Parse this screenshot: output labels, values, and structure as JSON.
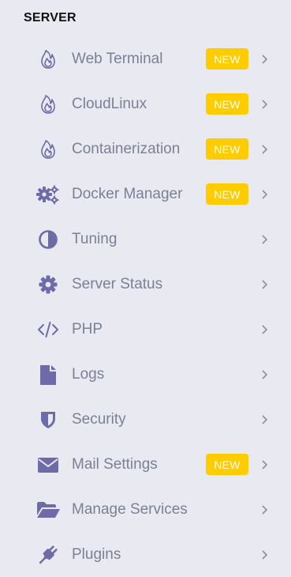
{
  "section_title": "SERVER",
  "colors": {
    "background": "#e8e9f1",
    "icon": "#6e6ca8",
    "label": "#7b8195",
    "badge": "#ffcc00",
    "chevron": "#8a8fa3"
  },
  "items": [
    {
      "label": "Web Terminal",
      "icon": "flame-icon",
      "badge": "NEW"
    },
    {
      "label": "CloudLinux",
      "icon": "flame-icon",
      "badge": "NEW"
    },
    {
      "label": "Containerization",
      "icon": "flame-icon",
      "badge": "NEW"
    },
    {
      "label": "Docker Manager",
      "icon": "gears-icon",
      "badge": "NEW"
    },
    {
      "label": "Tuning",
      "icon": "contrast-icon",
      "badge": ""
    },
    {
      "label": "Server Status",
      "icon": "gear-icon",
      "badge": ""
    },
    {
      "label": "PHP",
      "icon": "code-icon",
      "badge": ""
    },
    {
      "label": "Logs",
      "icon": "file-icon",
      "badge": ""
    },
    {
      "label": "Security",
      "icon": "shield-icon",
      "badge": ""
    },
    {
      "label": "Mail Settings",
      "icon": "envelope-icon",
      "badge": "NEW"
    },
    {
      "label": "Manage Services",
      "icon": "folder-open-icon",
      "badge": ""
    },
    {
      "label": "Plugins",
      "icon": "plug-icon",
      "badge": ""
    }
  ]
}
